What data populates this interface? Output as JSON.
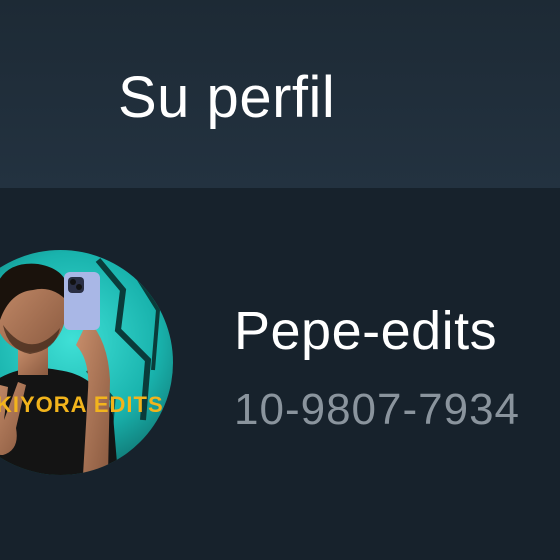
{
  "header": {
    "title": "Su perfil"
  },
  "profile": {
    "name": "Pepe-edits",
    "phone": "10-9807-7934",
    "avatar_overlay_text": "KIYORA EDITS",
    "avatar_icon": "profile-photo"
  },
  "colors": {
    "header_bg": "#233240",
    "body_bg": "#17222c",
    "primary_text": "#ffffff",
    "secondary_text": "#8a949d",
    "avatar_accent": "#22c9c2"
  }
}
